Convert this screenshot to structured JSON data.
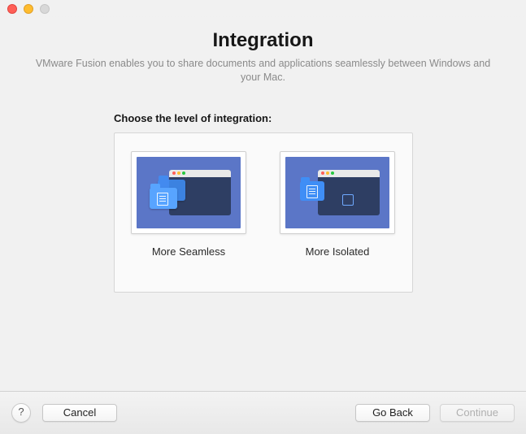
{
  "header": {
    "title": "Integration",
    "subtitle": "VMware Fusion enables you to share documents and applications seamlessly between Windows and your Mac."
  },
  "section": {
    "prompt": "Choose the level of integration:"
  },
  "options": {
    "seamless": {
      "label": "More Seamless"
    },
    "isolated": {
      "label": "More Isolated"
    }
  },
  "footer": {
    "help_glyph": "?",
    "cancel_label": "Cancel",
    "back_label": "Go Back",
    "continue_label": "Continue",
    "continue_enabled": false
  }
}
